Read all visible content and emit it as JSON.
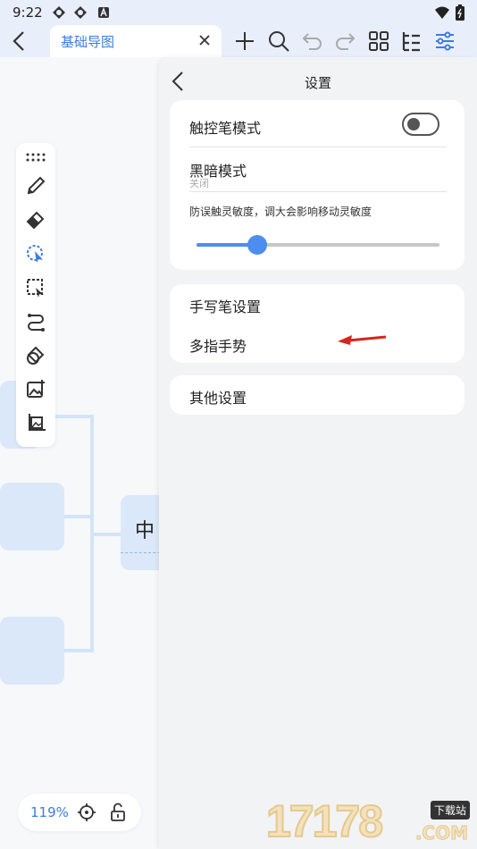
{
  "status_bar": {
    "time": "9:22"
  },
  "toolbar": {
    "document_tab_title": "基础导图"
  },
  "canvas": {
    "central_node_text": "中"
  },
  "zoom": {
    "level": "119%"
  },
  "settings": {
    "title": "设置",
    "stylus_mode_label": "触控笔模式",
    "stylus_mode_enabled": false,
    "dark_mode_label": "黑暗模式",
    "dark_mode_value": "关闭",
    "sensitivity_label": "防误触灵敏度，调大会影响移动灵敏度",
    "sensitivity_value": 0.25,
    "handwriting_label": "手写笔设置",
    "multitouch_label": "多指手势",
    "other_label": "其他设置"
  },
  "watermark": {
    "text": "17178",
    "badge": "下载站",
    "domain": ".COM"
  },
  "colors": {
    "accent": "#4e8df0",
    "annotation_arrow": "#d8241c"
  }
}
